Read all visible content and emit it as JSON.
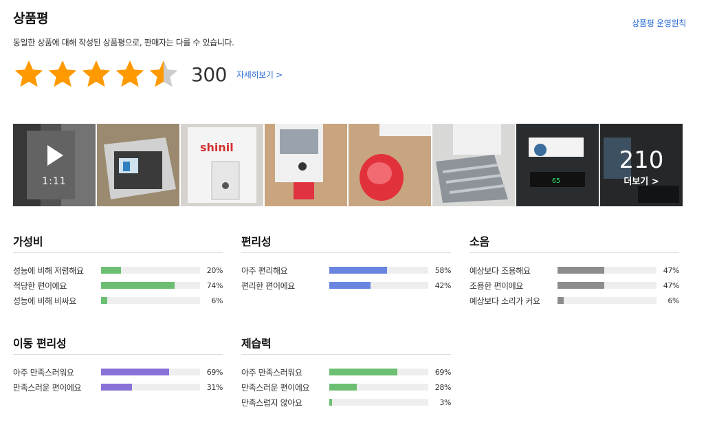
{
  "header": {
    "title": "상품평",
    "policy_link": "상품평 운영원칙",
    "notice": "동일한 상품에 대해 작성된 상품평으로, 판매자는 다를 수 있습니다."
  },
  "rating": {
    "stars": 4.5,
    "count": "300",
    "detail_link": "자세히보기 >",
    "star_color": "#ff9900"
  },
  "gallery": {
    "video_time": "1:11",
    "more_count": "210",
    "more_label": "더보기 >"
  },
  "colors": {
    "green": "#6cbf72",
    "blue": "#6a85e0",
    "gray": "#8c8c8c",
    "purple": "#8a71d8",
    "link": "#2b6bd6"
  },
  "sections": [
    {
      "title": "가성비",
      "rows": [
        {
          "label": "성능에 비해 저렴해요",
          "pct": 20,
          "pct_text": "20%"
        },
        {
          "label": "적당한 편이에요",
          "pct": 74,
          "pct_text": "74%"
        },
        {
          "label": "성능에 비해 비싸요",
          "pct": 6,
          "pct_text": "6%"
        }
      ]
    },
    {
      "title": "편리성",
      "rows": [
        {
          "label": "아주 편리해요",
          "pct": 58,
          "pct_text": "58%"
        },
        {
          "label": "편리한 편이에요",
          "pct": 42,
          "pct_text": "42%"
        }
      ]
    },
    {
      "title": "소음",
      "rows": [
        {
          "label": "예상보다 조용해요",
          "pct": 47,
          "pct_text": "47%"
        },
        {
          "label": "조용한 편이에요",
          "pct": 47,
          "pct_text": "47%"
        },
        {
          "label": "예상보다 소리가 커요",
          "pct": 6,
          "pct_text": "6%"
        }
      ]
    },
    {
      "title": "이동 편리성",
      "rows": [
        {
          "label": "아주 만족스러워요",
          "pct": 69,
          "pct_text": "69%"
        },
        {
          "label": "만족스러운 편이에요",
          "pct": 31,
          "pct_text": "31%"
        }
      ]
    },
    {
      "title": "제습력",
      "rows": [
        {
          "label": "아주 만족스러워요",
          "pct": 69,
          "pct_text": "69%"
        },
        {
          "label": "만족스러운 편이에요",
          "pct": 28,
          "pct_text": "28%"
        },
        {
          "label": "만족스럽지 않아요",
          "pct": 3,
          "pct_text": "3%"
        }
      ]
    }
  ]
}
